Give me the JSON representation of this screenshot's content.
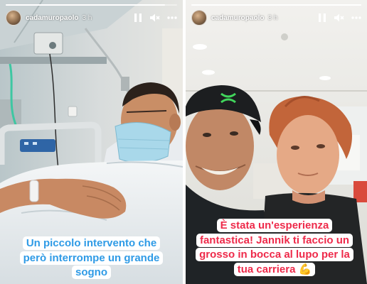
{
  "stories": [
    {
      "username": "cadamuropaolo",
      "time": "3 h",
      "progress": 0.93,
      "caption": "Un piccolo intervento che però interrompe un grande sogno",
      "caption_color": "#2f9be6"
    },
    {
      "username": "cadamuropaolo",
      "time": "3 h",
      "progress": 1.0,
      "caption": "È stata un'esperienza fantastica! Jannik ti faccio un grosso in bocca al lupo per la tua carriera 💪",
      "caption_color": "#ee2a4a"
    }
  ],
  "icons": {
    "pause": "pause-icon",
    "mute": "volume-muted-icon",
    "more": "more-options-icon",
    "logo": "under-armour-logo"
  }
}
